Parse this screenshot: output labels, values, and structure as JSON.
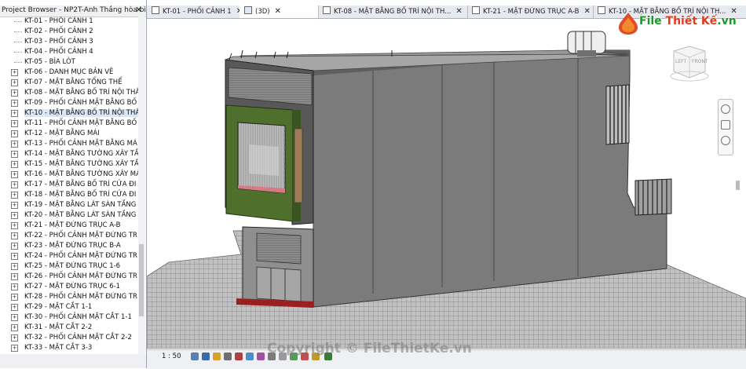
{
  "project_browser": {
    "title": "Project Browser - NP2T-Anh Thắng hòa bì...",
    "close": "✕",
    "items": [
      {
        "label": "KT-01 - PHỐI CẢNH 1",
        "expandable": false
      },
      {
        "label": "KT-02 - PHỐI CẢNH 2",
        "expandable": false
      },
      {
        "label": "KT-03 - PHỐI CẢNH 3",
        "expandable": false
      },
      {
        "label": "KT-04 - PHỐI CẢNH 4",
        "expandable": false
      },
      {
        "label": "KT-05 - BÌA LÓT",
        "expandable": false
      },
      {
        "label": "KT-06 - DANH MỤC BẢN VẼ",
        "expandable": true
      },
      {
        "label": "KT-07 - MẶT BẰNG TỔNG THỂ",
        "expandable": true
      },
      {
        "label": "KT-08 - MẶT BẰNG BỐ TRÍ NỘI THẤ",
        "expandable": true
      },
      {
        "label": "KT-09 - PHỐI CẢNH MẶT BẰNG BỐ",
        "expandable": true
      },
      {
        "label": "KT-10 - MẶT BẰNG BỐ TRÍ NỘI THẤ",
        "expandable": true,
        "selected": true
      },
      {
        "label": "KT-11 - PHỐI CẢNH MẶT BẰNG BỐ",
        "expandable": true
      },
      {
        "label": "KT-12 - MẶT BẰNG MÁI",
        "expandable": true
      },
      {
        "label": "KT-13 - PHỐI CẢNH MẶT BẰNG MÁ",
        "expandable": true
      },
      {
        "label": "KT-14 - MẶT BẰNG TƯỜNG XÂY TẦ",
        "expandable": true
      },
      {
        "label": "KT-15 - MẶT BẰNG TƯỜNG XÂY TẦ",
        "expandable": true
      },
      {
        "label": "KT-16 - MẶT BẰNG TƯỜNG XÂY MÁ",
        "expandable": true
      },
      {
        "label": "KT-17 - MẶT BẰNG BỐ TRÍ CỬA ĐI",
        "expandable": true
      },
      {
        "label": "KT-18 - MẶT BẰNG BỐ TRÍ CỬA ĐI",
        "expandable": true
      },
      {
        "label": "KT-19 - MẶT BẰNG LÁT SÀN TẦNG",
        "expandable": true
      },
      {
        "label": "KT-20 - MẶT BẰNG LÁT SÀN TẦNG",
        "expandable": true
      },
      {
        "label": "KT-21 - MẶT ĐỨNG TRỤC A-B",
        "expandable": true
      },
      {
        "label": "KT-22 - PHỐI CẢNH MẶT ĐỨNG TR",
        "expandable": true
      },
      {
        "label": "KT-23 - MẶT ĐỨNG TRỤC B-A",
        "expandable": true
      },
      {
        "label": "KT-24 - PHỐI CẢNH MẶT ĐỨNG TR",
        "expandable": true
      },
      {
        "label": "KT-25 - MẶT ĐỨNG TRỤC 1-6",
        "expandable": true
      },
      {
        "label": "KT-26 - PHỐI CẢNH MẶT ĐỨNG TR",
        "expandable": true
      },
      {
        "label": "KT-27 - MẶT ĐỨNG TRỤC 6-1",
        "expandable": true
      },
      {
        "label": "KT-28 - PHỐI CẢNH MẶT ĐỨNG TR",
        "expandable": true
      },
      {
        "label": "KT-29 - MẶT CẮT 1-1",
        "expandable": true
      },
      {
        "label": "KT-30 - PHỐI CẢNH MẶT CẮT 1-1",
        "expandable": true
      },
      {
        "label": "KT-31 - MẶT CẮT 2-2",
        "expandable": true
      },
      {
        "label": "KT-32 - PHỐI CẢNH MẶT CẮT 2-2",
        "expandable": true
      },
      {
        "label": "KT-33 - MẶT CẮT 3-3",
        "expandable": true
      }
    ]
  },
  "tabs": [
    {
      "label": "KT-01 - PHỐI CẢNH 1",
      "active": false,
      "icon": "sheet-icon"
    },
    {
      "label": "(3D)",
      "active": true,
      "icon": "3d-view-icon"
    },
    {
      "label": "KT-08 - MẶT BẰNG BỐ TRÍ NỘI TH...",
      "active": false,
      "icon": "sheet-icon"
    },
    {
      "label": "KT-21 - MẶT ĐỨNG TRỤC A-B",
      "active": false,
      "icon": "sheet-icon"
    },
    {
      "label": "KT-10 - MẶT BẰNG BỐ TRÍ NỘI TH...",
      "active": false,
      "icon": "sheet-icon"
    }
  ],
  "viewcube": {
    "left": "LEFT",
    "front": "FRONT"
  },
  "status": {
    "scale": "1 : 50"
  },
  "watermark": {
    "copyright": "Copyright © FileThietKe.vn",
    "brand_part1": "File",
    "brand_part2": "Thiết Kế",
    "brand_part3": ".vn"
  },
  "colors": {
    "building_gray": "#7b7b7b",
    "roof_gray": "#9a9a9a",
    "ground": "#8e8e8e",
    "facade_green": "#4f6f2c",
    "accent_brand": "#1a9a2a"
  }
}
